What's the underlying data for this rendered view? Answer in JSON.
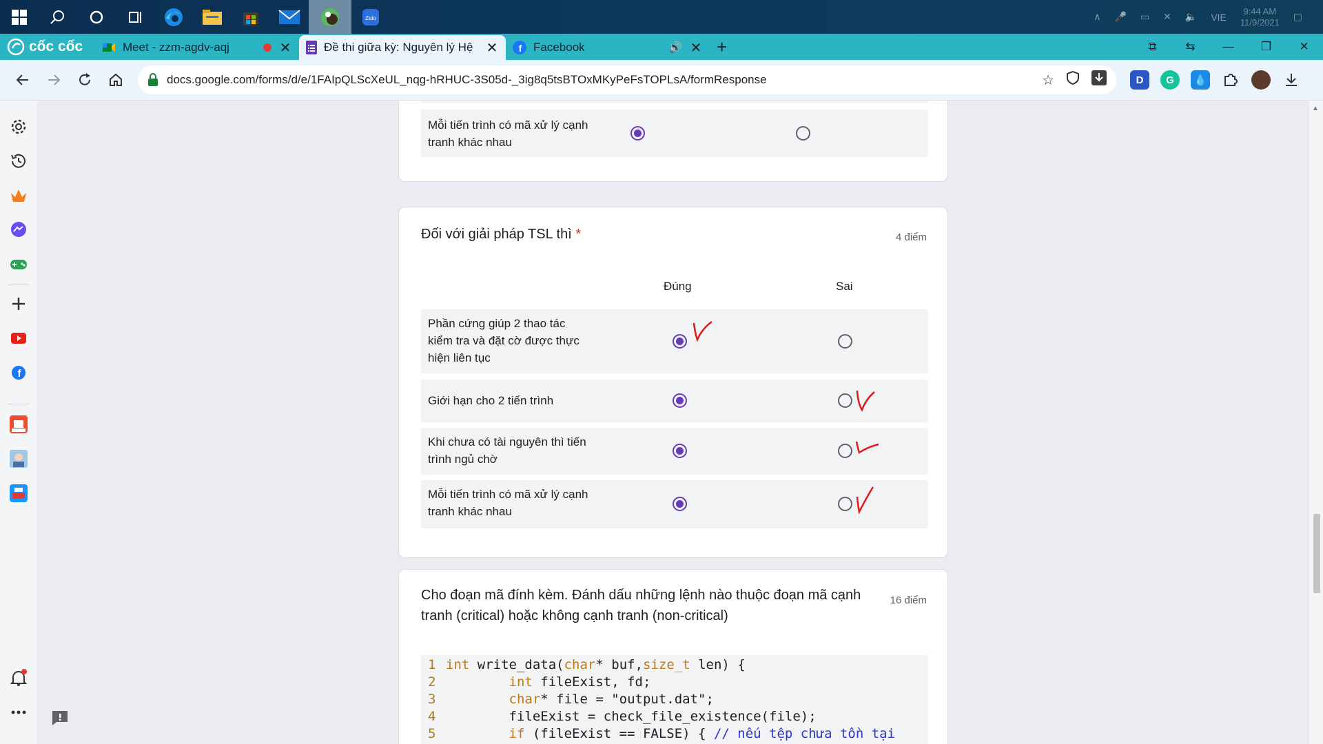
{
  "taskbar": {
    "language": "VIE",
    "time": "9:44 AM",
    "date": "11/9/2021"
  },
  "browser": {
    "brand": "cốc cốc",
    "tabs": [
      {
        "title": "Meet - zzm-agdv-aqj",
        "active": false
      },
      {
        "title": "Đề thi giữa kỳ: Nguyên lý Hệ",
        "active": true
      },
      {
        "title": "Facebook",
        "active": false
      }
    ],
    "url": "docs.google.com/forms/d/e/1FAIpQLScXeUL_nqg-hRHUC-3S05d-_3ig8q5tsBTOxMKyPeFsTOPLsA/formResponse",
    "ext_d_label": "D"
  },
  "form": {
    "prev_card": {
      "row_label": "Mỗi tiến trình có mã xử lý cạnh tranh khác nhau",
      "selected": "dung"
    },
    "tsl_question": {
      "title": "Đối với giải pháp TSL thì",
      "required_mark": "*",
      "points": "4 điểm",
      "col_true": "Đúng",
      "col_false": "Sai",
      "rows": [
        {
          "label": "Phần cứng giúp 2 thao tác kiểm tra và đặt cờ được thực hiện liên tục",
          "selected": "dung",
          "handwritten_check": "dung"
        },
        {
          "label": "Giới hạn cho 2 tiến trình",
          "selected": "dung",
          "handwritten_check": "sai"
        },
        {
          "label": "Khi chưa có tài nguyên thì tiến trình ngủ chờ",
          "selected": "dung",
          "handwritten_check": "sai"
        },
        {
          "label": "Mỗi tiến trình có mã xử lý cạnh tranh khác nhau",
          "selected": "dung",
          "handwritten_check": "sai"
        }
      ]
    },
    "code_question": {
      "title": "Cho đoạn mã đính kèm. Đánh dấu những lệnh nào thuộc đoạn mã cạnh tranh (critical) hoặc không cạnh tranh (non-critical)",
      "points": "16 điểm",
      "code_lines": [
        {
          "n": "1",
          "kw": "int",
          "rest": " write_data(",
          "kw2": "char",
          "rest2": "* buf,",
          "kw3": "size_t",
          "rest3": " len) {"
        },
        {
          "n": "2",
          "kw": "        int",
          "rest": " fileExist, fd;",
          "kw2": "",
          "rest2": "",
          "kw3": "",
          "rest3": ""
        },
        {
          "n": "3",
          "kw": "        char",
          "rest": "* file = \"output.dat\";",
          "kw2": "",
          "rest2": "",
          "kw3": "",
          "rest3": ""
        },
        {
          "n": "4",
          "kw": "",
          "rest": "        fileExist = check_file_existence(file);",
          "kw2": "",
          "rest2": "",
          "kw3": "",
          "rest3": ""
        },
        {
          "n": "5",
          "kw": "        if",
          "rest": " (fileExist == FALSE) { ",
          "kw2": "",
          "rest2": "",
          "kw3": "",
          "rest3": "",
          "comment": "// nếu tệp chưa tồn tại"
        }
      ]
    }
  },
  "colors": {
    "accent": "#673ab7",
    "tabstrip": "#2bb5c4",
    "handwriting": "#e01919"
  }
}
